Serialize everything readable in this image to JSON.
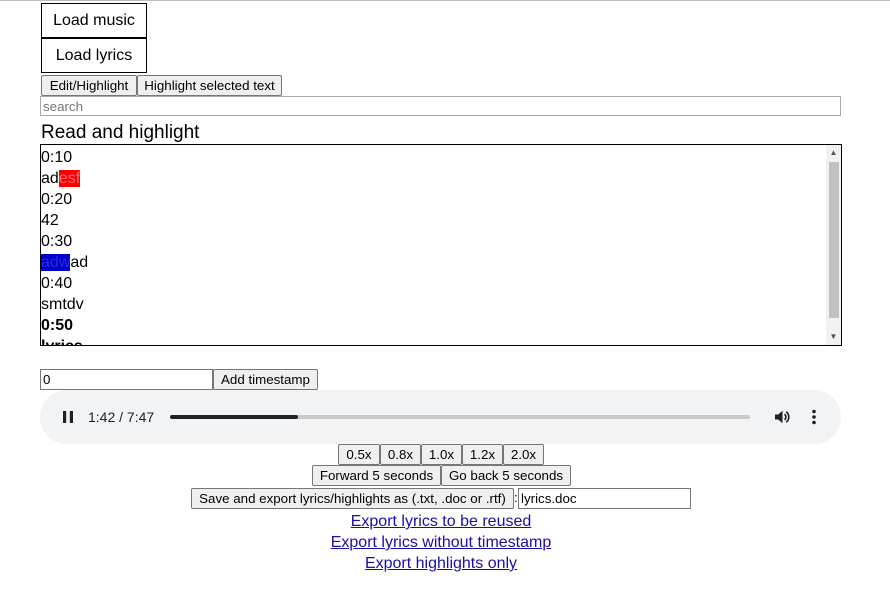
{
  "buttons": {
    "load_music": "Load music",
    "load_lyrics": "Load lyrics",
    "edit_highlight": "Edit/Highlight",
    "highlight_selected": "Highlight selected text",
    "add_timestamp": "Add timestamp",
    "forward": "Forward 5 seconds",
    "back": "Go back 5 seconds",
    "save_export": "Save and export lyrics/highlights as (.txt, .doc or .rtf)"
  },
  "search": {
    "placeholder": "search"
  },
  "section_title": "Read and highlight",
  "lyrics": {
    "lines": [
      {
        "text": "0:10"
      },
      {
        "pre": "ad",
        "hl": "esf",
        "post": "",
        "hl_color": "#ff0000"
      },
      {
        "text": "0:20"
      },
      {
        "text": "42"
      },
      {
        "text": "0:30"
      },
      {
        "pre": "",
        "hl": "adw",
        "post": "ad",
        "hl_color": "#0000cc"
      },
      {
        "text": "0:40"
      },
      {
        "text": "smtdv"
      },
      {
        "text": "0:50",
        "bold": true
      },
      {
        "text": "lyrics",
        "bold": true
      }
    ]
  },
  "timestamp": {
    "value": "0"
  },
  "player": {
    "time": "1:42 / 7:47",
    "progress": 0.22,
    "icons": {
      "pause": "pause-icon",
      "volume": "volume-icon",
      "menu": "more-vert-icon"
    }
  },
  "speeds": [
    "0.5x",
    "0.8x",
    "1.0x",
    "1.2x",
    "2.0x"
  ],
  "export": {
    "separator": ":",
    "filename": "lyrics.doc"
  },
  "links": {
    "reuse": "Export lyrics to be reused",
    "no_timestamp": "Export lyrics without timestamp",
    "highlights_only": "Export highlights only"
  }
}
